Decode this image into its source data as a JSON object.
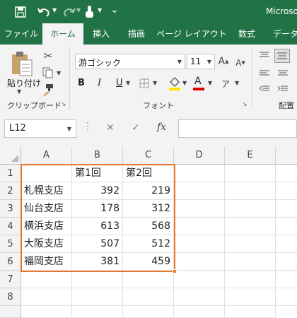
{
  "app": {
    "title": "Microso"
  },
  "quick_access": {
    "save_icon": "save-icon",
    "undo_icon": "undo-icon",
    "redo_icon": "redo-icon",
    "touch_icon": "touch-mode-icon",
    "customize_icon": "customize-icon"
  },
  "tabs": [
    {
      "label": "ファイル",
      "active": false
    },
    {
      "label": "ホーム",
      "active": true
    },
    {
      "label": "挿入",
      "active": false
    },
    {
      "label": "描画",
      "active": false
    },
    {
      "label": "ページ レイアウト",
      "active": false
    },
    {
      "label": "数式",
      "active": false
    },
    {
      "label": "データ",
      "active": false
    }
  ],
  "ribbon": {
    "clipboard": {
      "label": "クリップボード",
      "paste_label": "貼り付け"
    },
    "font": {
      "label": "フォント",
      "font_name": "游ゴシック",
      "font_size": "11",
      "bold": "B",
      "italic": "I",
      "underline": "U",
      "font_color_glyph": "A"
    },
    "alignment": {
      "label": "配置"
    }
  },
  "formula_bar": {
    "name_box": "L12",
    "cancel": "✕",
    "enter": "✓",
    "fx": "fx",
    "value": ""
  },
  "sheet": {
    "columns": [
      "A",
      "B",
      "C",
      "D",
      "E"
    ],
    "rows": [
      "1",
      "2",
      "3",
      "4",
      "5",
      "6",
      "7",
      "8"
    ],
    "header_row": [
      "",
      "第1回",
      "第2回"
    ],
    "data_rows": [
      [
        "札幌支店",
        "392",
        "219"
      ],
      [
        "仙台支店",
        "178",
        "312"
      ],
      [
        "横浜支店",
        "613",
        "568"
      ],
      [
        "大阪支店",
        "507",
        "512"
      ],
      [
        "福岡支店",
        "381",
        "459"
      ]
    ]
  },
  "colors": {
    "excel_green": "#217346",
    "selection": "#e8772e"
  }
}
